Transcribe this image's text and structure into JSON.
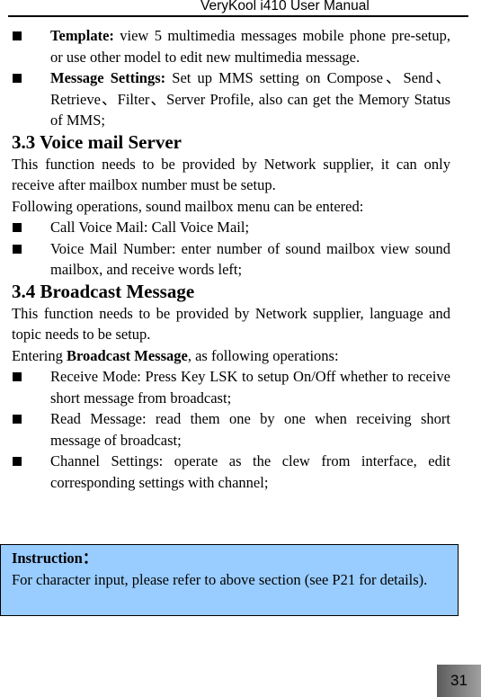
{
  "header": {
    "title": "VeryKool i410 User Manual"
  },
  "mms_items": [
    {
      "label": "Template:",
      "text": " view 5 multimedia messages mobile phone pre-setup, or use other model to edit new multimedia message."
    },
    {
      "label": "Message Settings:",
      "text": " Set up MMS setting on Compose、Send、Retrieve、Filter、Server Profile, also can get the Memory Status of MMS;"
    }
  ],
  "voicemail": {
    "heading": "3.3 Voice mail Server",
    "intro": "This function needs to be provided by Network supplier, it can only receive after mailbox number must be setup.",
    "ops_intro": "Following operations, sound mailbox menu can be entered:",
    "items": [
      "Call Voice Mail: Call Voice Mail;",
      "Voice Mail Number: enter number of sound mailbox view sound mailbox, and receive words left;"
    ]
  },
  "broadcast": {
    "heading": "3.4 Broadcast Message",
    "intro": "This function needs to be provided by Network supplier, language and topic needs to be setup.",
    "ops_prefix": "Entering ",
    "ops_bold": "Broadcast Message",
    "ops_suffix": ", as following operations:",
    "items": [
      "Receive Mode: Press Key LSK to setup On/Off whether to receive short message from broadcast;",
      "Read Message: read them one by one when receiving short message of broadcast;",
      "Channel Settings: operate as the clew from interface, edit corresponding settings with channel;"
    ]
  },
  "note": {
    "title": "Instruction：",
    "text": "For character input, please refer to above section (see P21 for details).",
    "background": "#99CCFF"
  },
  "page_number": "31"
}
